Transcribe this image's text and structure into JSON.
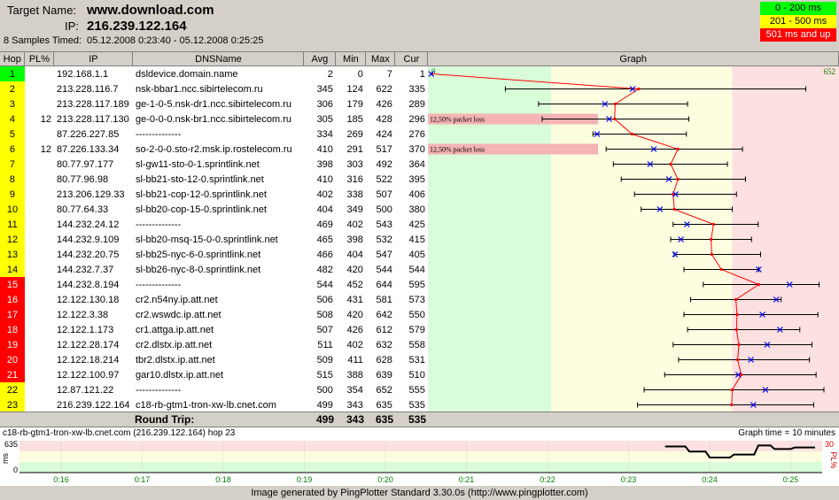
{
  "header": {
    "target_label": "Target Name:",
    "target_value": "www.download.com",
    "ip_label": "IP:",
    "ip_value": "216.239.122.164",
    "samples_label": "8 Samples Timed:",
    "samples_value": "05.12.2008 0:23:40 - 05.12.2008 0:25:25"
  },
  "legend": [
    {
      "label": "0 - 200 ms",
      "color": "#00ff00"
    },
    {
      "label": "201 - 500 ms",
      "color": "#ffff00"
    },
    {
      "label": "501 ms and up",
      "color": "#ff0000"
    }
  ],
  "columns": [
    "Hop",
    "PL%",
    "IP",
    "DNSName",
    "Avg",
    "Min",
    "Max",
    "Cur",
    "Graph"
  ],
  "graph_max_label": "652",
  "graph_zero_label": "0",
  "graph_scale_max": 652,
  "rows": [
    {
      "hop": "1",
      "pl": "",
      "ip": "192.168.1.1",
      "dns": "dsldevice.domain.name",
      "avg": 2,
      "min": 0,
      "max": 7,
      "cur": 1,
      "color": "#00ff00"
    },
    {
      "hop": "2",
      "pl": "",
      "ip": "213.228.116.7",
      "dns": "nsk-bbar1.ncc.sibirtelecom.ru",
      "avg": 345,
      "min": 124,
      "max": 622,
      "cur": 335,
      "color": "#ffff00"
    },
    {
      "hop": "3",
      "pl": "",
      "ip": "213.228.117.189",
      "dns": "ge-1-0-5.nsk-dr1.ncc.sibirtelecom.ru",
      "avg": 306,
      "min": 179,
      "max": 426,
      "cur": 289,
      "color": "#ffff00"
    },
    {
      "hop": "4",
      "pl": "12",
      "ip": "213.228.117.130",
      "dns": "ge-0-0-0.nsk-br1.ncc.sibirtelecom.ru",
      "avg": 305,
      "min": 185,
      "max": 428,
      "cur": 296,
      "color": "#ffff00",
      "loss": "12,50% packet loss"
    },
    {
      "hop": "5",
      "pl": "",
      "ip": "87.226.227.85",
      "dns": "--------------",
      "avg": 334,
      "min": 269,
      "max": 424,
      "cur": 276,
      "color": "#ffff00"
    },
    {
      "hop": "6",
      "pl": "12",
      "ip": "87.226.133.34",
      "dns": "so-2-0-0.sto-r2.msk.ip.rostelecom.ru",
      "avg": 410,
      "min": 291,
      "max": 517,
      "cur": 370,
      "color": "#ffff00",
      "loss": "12,50% packet loss"
    },
    {
      "hop": "7",
      "pl": "",
      "ip": "80.77.97.177",
      "dns": "sl-gw11-sto-0-1.sprintlink.net",
      "avg": 398,
      "min": 303,
      "max": 492,
      "cur": 364,
      "color": "#ffff00"
    },
    {
      "hop": "8",
      "pl": "",
      "ip": "80.77.96.98",
      "dns": "sl-bb21-sto-12-0.sprintlink.net",
      "avg": 410,
      "min": 316,
      "max": 522,
      "cur": 395,
      "color": "#ffff00"
    },
    {
      "hop": "9",
      "pl": "",
      "ip": "213.206.129.33",
      "dns": "sl-bb21-cop-12-0.sprintlink.net",
      "avg": 402,
      "min": 338,
      "max": 507,
      "cur": 406,
      "color": "#ffff00"
    },
    {
      "hop": "10",
      "pl": "",
      "ip": "80.77.64.33",
      "dns": "sl-bb20-cop-15-0.sprintlink.net",
      "avg": 404,
      "min": 349,
      "max": 500,
      "cur": 380,
      "color": "#ffff00"
    },
    {
      "hop": "11",
      "pl": "",
      "ip": "144.232.24.12",
      "dns": "--------------",
      "avg": 469,
      "min": 402,
      "max": 543,
      "cur": 425,
      "color": "#ffff00"
    },
    {
      "hop": "12",
      "pl": "",
      "ip": "144.232.9.109",
      "dns": "sl-bb20-msq-15-0-0.sprintlink.net",
      "avg": 465,
      "min": 398,
      "max": 532,
      "cur": 415,
      "color": "#ffff00"
    },
    {
      "hop": "13",
      "pl": "",
      "ip": "144.232.20.75",
      "dns": "sl-bb25-nyc-6-0.sprintlink.net",
      "avg": 466,
      "min": 404,
      "max": 547,
      "cur": 405,
      "color": "#ffff00"
    },
    {
      "hop": "14",
      "pl": "",
      "ip": "144.232.7.37",
      "dns": "sl-bb26-nyc-8-0.sprintlink.net",
      "avg": 482,
      "min": 420,
      "max": 544,
      "cur": 544,
      "color": "#ffff00"
    },
    {
      "hop": "15",
      "pl": "",
      "ip": "144.232.8.194",
      "dns": "--------------",
      "avg": 544,
      "min": 452,
      "max": 644,
      "cur": 595,
      "color": "#ff0000"
    },
    {
      "hop": "16",
      "pl": "",
      "ip": "12.122.130.18",
      "dns": "cr2.n54ny.ip.att.net",
      "avg": 506,
      "min": 431,
      "max": 581,
      "cur": 573,
      "color": "#ff0000"
    },
    {
      "hop": "17",
      "pl": "",
      "ip": "12.122.3.38",
      "dns": "cr2.wswdc.ip.att.net",
      "avg": 508,
      "min": 420,
      "max": 642,
      "cur": 550,
      "color": "#ff0000"
    },
    {
      "hop": "18",
      "pl": "",
      "ip": "12.122.1.173",
      "dns": "cr1.attga.ip.att.net",
      "avg": 507,
      "min": 426,
      "max": 612,
      "cur": 579,
      "color": "#ff0000"
    },
    {
      "hop": "19",
      "pl": "",
      "ip": "12.122.28.174",
      "dns": "cr2.dlstx.ip.att.net",
      "avg": 511,
      "min": 402,
      "max": 632,
      "cur": 558,
      "color": "#ff0000"
    },
    {
      "hop": "20",
      "pl": "",
      "ip": "12.122.18.214",
      "dns": "tbr2.dlstx.ip.att.net",
      "avg": 509,
      "min": 411,
      "max": 628,
      "cur": 531,
      "color": "#ff0000"
    },
    {
      "hop": "21",
      "pl": "",
      "ip": "12.122.100.97",
      "dns": "gar10.dlstx.ip.att.net",
      "avg": 515,
      "min": 388,
      "max": 639,
      "cur": 510,
      "color": "#ff0000"
    },
    {
      "hop": "22",
      "pl": "",
      "ip": "12.87.121.22",
      "dns": "--------------",
      "avg": 500,
      "min": 354,
      "max": 652,
      "cur": 555,
      "color": "#ffff00"
    },
    {
      "hop": "23",
      "pl": "",
      "ip": "216.239.122.164",
      "dns": "c18-rb-gtm1-tron-xw-lb.cnet.com",
      "avg": 499,
      "min": 343,
      "max": 635,
      "cur": 535,
      "color": "#ffff00"
    }
  ],
  "round_trip": {
    "label": "Round Trip:",
    "avg": "499",
    "min": "343",
    "max": "635",
    "cur": "535"
  },
  "time_graph": {
    "title": "c18-rb-gtm1-tron-xw-lb.cnet.com (216.239.122.164) hop 23",
    "graph_time": "Graph time = 10 minutes",
    "y_max": "635",
    "y_min": "0",
    "y_unit": "ms",
    "pl_max": "30",
    "pl_unit": "PL%",
    "x_ticks": [
      "0:16",
      "0:17",
      "0:18",
      "0:19",
      "0:20",
      "0:21",
      "0:22",
      "0:23",
      "0:24",
      "0:25"
    ],
    "series": [
      {
        "t": 23.45,
        "ms": 520
      },
      {
        "t": 23.7,
        "ms": 520
      },
      {
        "t": 23.75,
        "ms": 420
      },
      {
        "t": 23.95,
        "ms": 420
      },
      {
        "t": 24.0,
        "ms": 300
      },
      {
        "t": 24.25,
        "ms": 300
      },
      {
        "t": 24.3,
        "ms": 360
      },
      {
        "t": 24.55,
        "ms": 360
      },
      {
        "t": 24.6,
        "ms": 540
      },
      {
        "t": 24.75,
        "ms": 540
      },
      {
        "t": 24.8,
        "ms": 470
      },
      {
        "t": 25.0,
        "ms": 470
      },
      {
        "t": 25.05,
        "ms": 500
      },
      {
        "t": 25.3,
        "ms": 500
      }
    ]
  },
  "footer": "Image generated by PingPlotter Standard 3.30.0s (http://www.pingplotter.com)"
}
